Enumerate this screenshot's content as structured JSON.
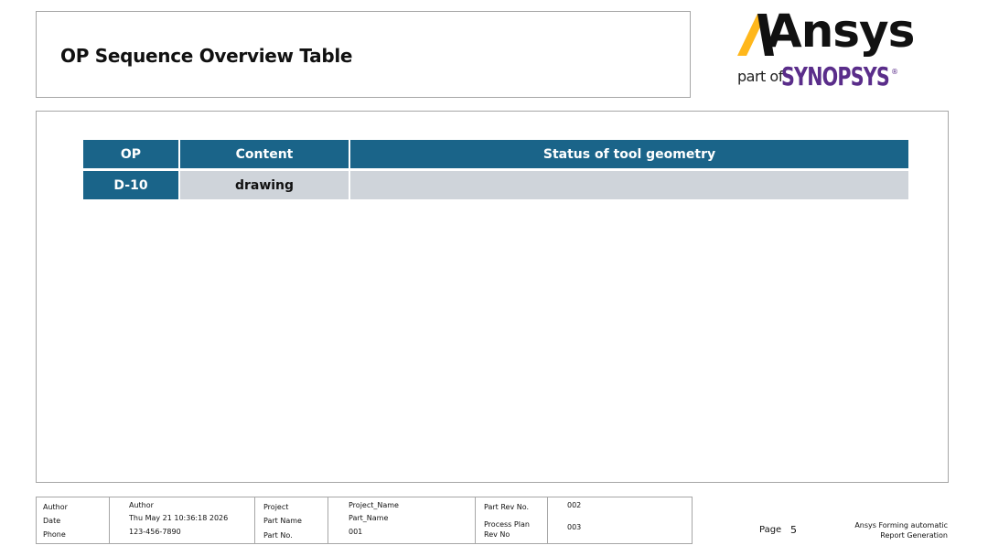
{
  "header": {
    "title": "OP Sequence Overview Table"
  },
  "logo": {
    "brand": "Ansys",
    "part_of": "part of",
    "parent": "SYNOPSYS",
    "reg": "®"
  },
  "table": {
    "headers": [
      "OP",
      "Content",
      "Status of tool geometry"
    ],
    "rows": [
      {
        "op": "D-10",
        "content": "drawing",
        "status": ""
      }
    ]
  },
  "footer": {
    "author_label": "Author",
    "author_value": "Author",
    "date_label": "Date",
    "date_value": "Thu May 21 10:36:18 2026",
    "phone_label": "Phone",
    "phone_value": "123-456-7890",
    "project_label": "Project",
    "project_value": "Project_Name",
    "part_name_label": "Part Name",
    "part_name_value": "Part_Name",
    "part_no_label": "Part No.",
    "part_no_value": "001",
    "part_rev_label": "Part Rev No.",
    "part_rev_value": "002",
    "process_plan_label_1": "Process Plan",
    "process_plan_label_2": "Rev No",
    "process_plan_value": "003",
    "page_label": "Page",
    "page_number": "5",
    "brand_note_1": "Ansys Forming automatic",
    "brand_note_2": "Report Generation"
  },
  "colors": {
    "header_blue": "#1a6489",
    "cell_gray": "#cfd4da",
    "logo_yellow": "#ffb71b",
    "synopsys_purple": "#5a2d8a"
  }
}
